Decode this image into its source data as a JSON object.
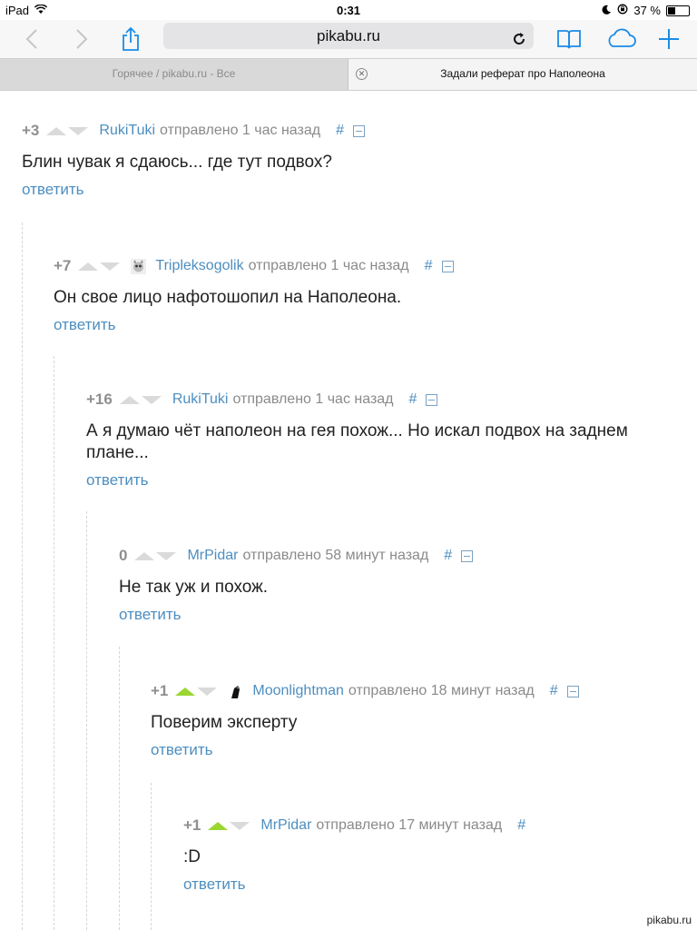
{
  "status_bar": {
    "device": "iPad",
    "time": "0:31",
    "battery": "37 %",
    "battery_level": 0.37
  },
  "toolbar": {
    "url": "pikabu.ru"
  },
  "tabs": [
    {
      "title": "Горячее / pikabu.ru - Все"
    },
    {
      "title": "Задали реферат про Наполеона"
    }
  ],
  "comments": [
    {
      "rating": "+3",
      "author": "RukiTuki",
      "sent": "отправлено 1 час назад",
      "hash": "#",
      "text": "Блин чувак я сдаюсь... где тут подвох?",
      "reply": "ответить"
    },
    {
      "rating": "+7",
      "author": "Tripleksogolik",
      "sent": "отправлено 1 час назад",
      "hash": "#",
      "text": "Он свое лицо нафотошопил на Наполеона.",
      "reply": "ответить"
    },
    {
      "rating": "+16",
      "author": "RukiTuki",
      "sent": "отправлено 1 час назад",
      "hash": "#",
      "text": "А я думаю чёт наполеон на гея похож... Но искал подвох на заднем плане...",
      "reply": "ответить"
    },
    {
      "rating": "0",
      "author": "MrPidar",
      "sent": "отправлено 58 минут назад",
      "hash": "#",
      "text": "Не так уж и похож.",
      "reply": "ответить"
    },
    {
      "rating": "+1",
      "author": "Moonlightman",
      "sent": "отправлено 18 минут назад",
      "hash": "#",
      "text": "Поверим эксперту",
      "reply": "ответить"
    },
    {
      "rating": "+1",
      "author": "MrPidar",
      "sent": "отправлено 17 минут назад",
      "hash": "#",
      "text": ":D",
      "reply": "ответить"
    }
  ],
  "watermark": "pikabu.ru"
}
